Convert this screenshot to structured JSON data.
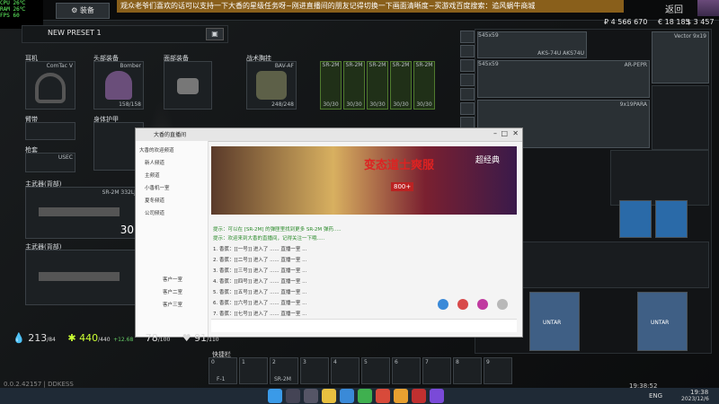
{
  "overlay_banner": "观众老爷们喜欢的话可以支持一下大香的星级任务呀~刚进直播间的朋友记得切换一下画面清晰度~买游戏百度搜索：追风蜗牛商城",
  "top": {
    "tab_label": "装备",
    "perf": [
      "CPU",
      "RAM",
      "FPS"
    ],
    "perf_values": [
      "26℃",
      "26℃",
      "60"
    ],
    "roubles": "₽ 4 566 670",
    "euros": "€ 18 185",
    "dollars": "$ 3 457",
    "back_label": "返回",
    "vendor_label": "Vector 9x19"
  },
  "preset": {
    "name": "NEW PRESET 1"
  },
  "slots": {
    "earpiece": "耳机",
    "earpiece_item": "ComTac V",
    "headwear": "头部装备",
    "headwear_item": "Bomber",
    "headwear_dur": "158/158",
    "faceCover": "面部装备",
    "tactical_rig": "战术胸挂",
    "rig_item": "BAV-AF",
    "rig_dur": "248/248",
    "armband": "臂带",
    "body_armor": "身体护甲",
    "eyewear": "面部装备",
    "holster": "枪套",
    "holster_item": "USEC",
    "primary": "主武器(背部)",
    "primary_item": "SR-2M 332LJ",
    "primary_ammo": "30",
    "primary2": "主武器(背部)",
    "mags": [
      "SR-2M",
      "SR-2M",
      "SR-2M",
      "SR-2M",
      "SR-2M"
    ],
    "mag_counts": [
      "30/30",
      "30/30",
      "30/30",
      "30/30",
      "30/30"
    ]
  },
  "stats": {
    "hydration": "213",
    "hydration_sub": "/84",
    "energy": "440",
    "energy_sub": "/440",
    "energy_delta": "+12.68",
    "weight": "78",
    "weight_sub": "/100",
    "health": "91",
    "health_sub": "/110"
  },
  "hotbar": {
    "title": "快捷栏",
    "keys": [
      "0",
      "1",
      "2",
      "3",
      "4",
      "5",
      "6",
      "7",
      "8",
      "9"
    ],
    "labels": [
      "F-1",
      "",
      "SR-2M",
      "",
      "",
      "",
      "",
      "",
      "",
      ""
    ]
  },
  "version": "0.0.2.42157 | DDKESS",
  "right_items": [
    {
      "name": "AKS-74U AKS74U",
      "size": "545x59"
    },
    {
      "name": "AR-PEPR",
      "size": "545x59"
    },
    {
      "name": "9x19PARA",
      "size": ""
    },
    {
      "name": "UNTAR",
      "size": ""
    },
    {
      "name": "UNTAR",
      "size": ""
    }
  ],
  "chat": {
    "title": "大香的直播间",
    "channels": [
      "大香的欢迎频道",
      "新人频道",
      "主频道",
      "小香机一室",
      "夏冬频道",
      "公司频道",
      "客户一室",
      "客户二室",
      "客户三室"
    ],
    "messages": [
      "提示：可以在 [SR-2M] 的弹匣里找到更多 SR-2M 弹药.....",
      "提示：欢迎来到大香的直播间，记得关注一下哦.....",
      "1. 香蕉：[[一号]] 进入了 ...... 直播一室 ...",
      "2. 香蕉：[[二号]] 进入了 ...... 直播一室 ...",
      "3. 香蕉：[[三号]] 进入了 ...... 直播一室 ...",
      "4. 香蕉：[[四号]] 进入了 ...... 直播一室 ...",
      "5. 香蕉：[[五号]] 进入了 ...... 直播一室 ...",
      "6. 香蕉：[[六号]] 进入了 ...... 直播一室 ...",
      "7. 香蕉：[[七号]] 进入了 ...... 直播一室 ..."
    ],
    "ad_title": "变态道士爽服",
    "ad_sub": "超经典",
    "ad_badge": "800+"
  },
  "taskbar": {
    "clock": "19:38",
    "date": "2023/12/6",
    "lang": "ENG",
    "chat_time": "19:38:52"
  }
}
